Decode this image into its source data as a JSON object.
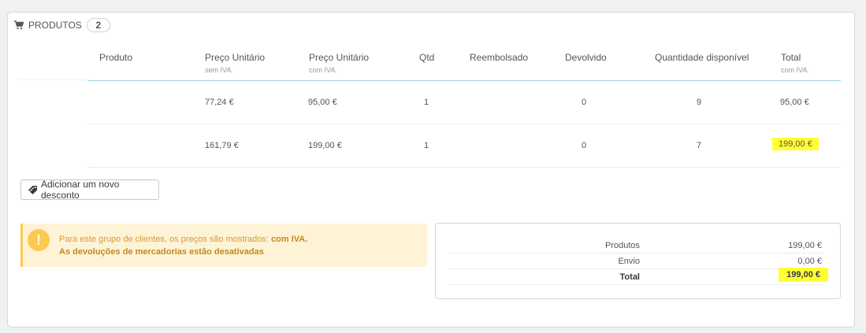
{
  "panel": {
    "title": "PRODUTOS",
    "count": "2"
  },
  "columns": [
    {
      "label": "Produto",
      "sub": ""
    },
    {
      "label": "Preço Unitário",
      "sub": "sem IVA."
    },
    {
      "label": "Preço Unitário",
      "sub": "com IVA."
    },
    {
      "label": "Qtd",
      "sub": ""
    },
    {
      "label": "Reembolsado",
      "sub": ""
    },
    {
      "label": "Devolvido",
      "sub": ""
    },
    {
      "label": "Quantidade disponível",
      "sub": ""
    },
    {
      "label": "Total",
      "sub": "com IVA."
    }
  ],
  "rows": [
    {
      "price_excl": "77,24 €",
      "price_incl": "95,00 €",
      "qty": "1",
      "refunded": "",
      "returned": "0",
      "available": "9",
      "total": "95,00 €"
    },
    {
      "price_excl": "161,79 €",
      "price_incl": "199,00 €",
      "qty": "1",
      "refunded": "",
      "returned": "0",
      "available": "7",
      "total": "199,00 €"
    }
  ],
  "actions": {
    "add_discount": "Adicionar um novo desconto"
  },
  "alert": {
    "line1_prefix": "Para este grupo de clientes, os preços são mostrados:",
    "line1_bold": "com IVA.",
    "line2": "As devoluções de mercadorias estão desativadas"
  },
  "totals": [
    {
      "label": "Produtos",
      "value": "199,00 €"
    },
    {
      "label": "Envio",
      "value": "0,00 €"
    },
    {
      "label": "Total",
      "value": "199,00 €"
    }
  ],
  "colors": {
    "highlight": "#ffff33",
    "warning": "#fcc94f",
    "header_rule": "#a0d0eb"
  }
}
